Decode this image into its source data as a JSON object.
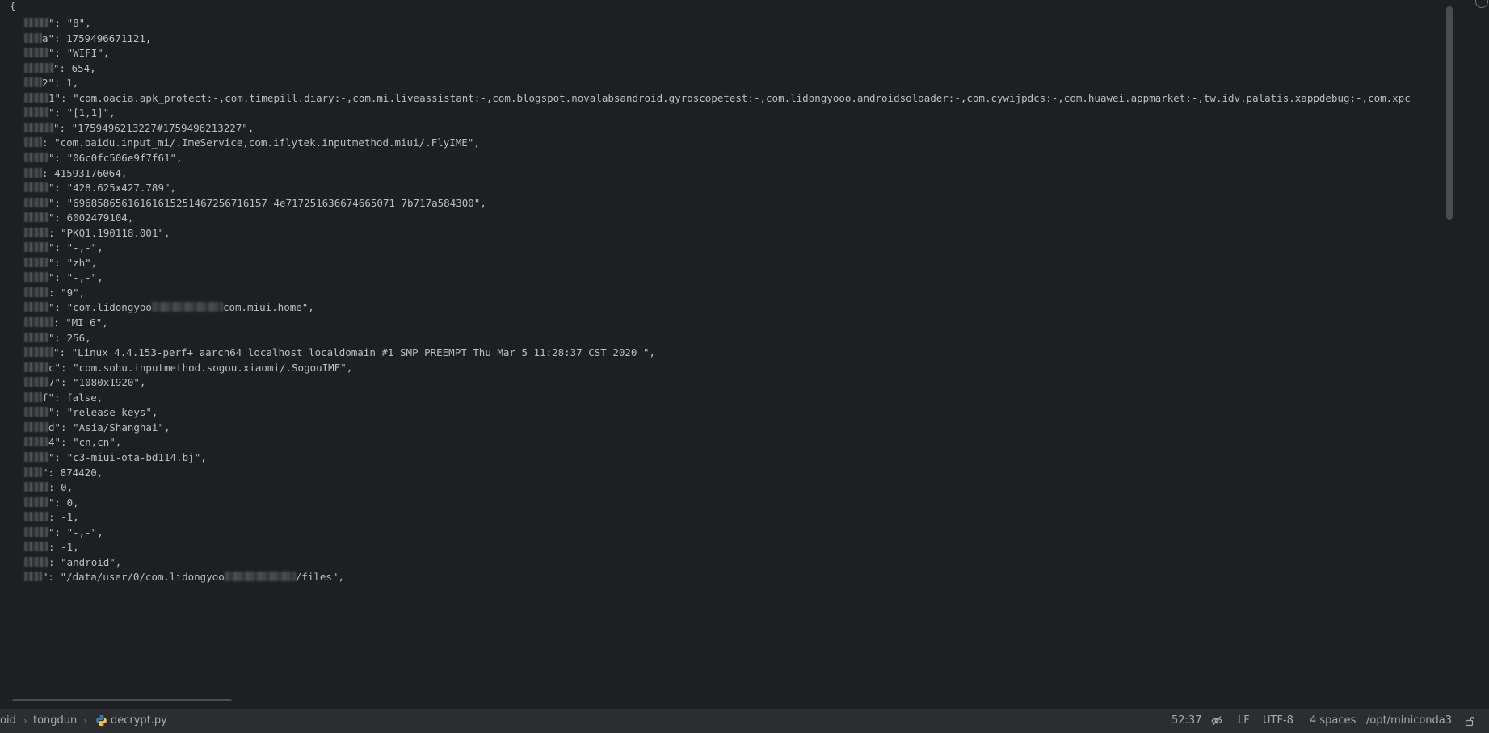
{
  "editor": {
    "open_brace": "{",
    "lines": [
      {
        "key_visible": "\": ",
        "value": "\"8\","
      },
      {
        "key_visible": "a\": ",
        "value": "1759496671121,"
      },
      {
        "key_visible": "\": ",
        "value": "\"WIFI\","
      },
      {
        "key_visible": "\": ",
        "value": "654,"
      },
      {
        "key_visible": "2\": ",
        "value": "1,"
      },
      {
        "key_visible": "1\": ",
        "value": "\"com.oacia.apk_protect:-,com.timepill.diary:-,com.mi.liveassistant:-,com.blogspot.novalabsandroid.gyroscopetest:-,com.lidongyooo.androidsoloader:-,com.cywijpdcs:-,com.huawei.appmarket:-,tw.idv.palatis.xappdebug:-,com.xpc"
      },
      {
        "key_visible": "\": ",
        "value": "\"[1,1]\","
      },
      {
        "key_visible": "\": ",
        "value": "\"1759496213227#1759496213227\","
      },
      {
        "key_visible": ": ",
        "value": "\"com.baidu.input_mi/.ImeService,com.iflytek.inputmethod.miui/.FlyIME\","
      },
      {
        "key_visible": "\": ",
        "value": "\"06c0fc506e9f7f61\","
      },
      {
        "key_visible": ": ",
        "value": "41593176064,"
      },
      {
        "key_visible": "\": ",
        "value": "\"428.625x427.789\","
      },
      {
        "key_visible": "\": ",
        "value": "\"69685865616161615251467256716157 4e717251636674665071 7b717a584300\","
      },
      {
        "key_visible": "\": ",
        "value": "6002479104,"
      },
      {
        "key_visible": ": ",
        "value": "\"PKQ1.190118.001\","
      },
      {
        "key_visible": "\": ",
        "value": "\"-,-\","
      },
      {
        "key_visible": "\": ",
        "value": "\"zh\","
      },
      {
        "key_visible": "\": ",
        "value": "\"-,-\","
      },
      {
        "key_visible": ": ",
        "value": "\"9\","
      },
      {
        "key_visible": "\": ",
        "value": "\"com.lidongyoo",
        "value_after_redaction": "com.miui.home\","
      },
      {
        "key_visible": ": ",
        "value": "\"MI 6\","
      },
      {
        "key_visible": "\": ",
        "value": "256,"
      },
      {
        "key_visible": "\": ",
        "value": "\"Linux 4.4.153-perf+ aarch64 localhost localdomain #1 SMP PREEMPT Thu Mar 5 11:28:37 CST 2020 \","
      },
      {
        "key_visible": "c\": ",
        "value": "\"com.sohu.inputmethod.sogou.xiaomi/.SogouIME\","
      },
      {
        "key_visible": "7\": ",
        "value": "\"1080x1920\","
      },
      {
        "key_visible": "f\": ",
        "value": "false,"
      },
      {
        "key_visible": "\": ",
        "value": "\"release-keys\","
      },
      {
        "key_visible": "d\": ",
        "value": "\"Asia/Shanghai\","
      },
      {
        "key_visible": "4\": ",
        "value": "\"cn,cn\","
      },
      {
        "key_visible": "\": ",
        "value": "\"c3-miui-ota-bd114.bj\","
      },
      {
        "key_visible": "\": ",
        "value": "874420,"
      },
      {
        "key_visible": ": ",
        "value": "0,"
      },
      {
        "key_visible": "\": ",
        "value": "0,"
      },
      {
        "key_visible": ": ",
        "value": "-1,"
      },
      {
        "key_visible": "\": ",
        "value": "\"-,-\","
      },
      {
        "key_visible": ": ",
        "value": "-1,"
      },
      {
        "key_visible": ": ",
        "value": "\"android\","
      },
      {
        "key_visible": "\": ",
        "value": "\"/data/user/0/com.lidongyoo",
        "value_after_redaction": "/files\","
      }
    ]
  },
  "statusbar": {
    "breadcrumb": [
      "oid",
      "tongdun",
      "decrypt.py"
    ],
    "cursor_position": "52:37",
    "line_separator": "LF",
    "encoding": "UTF-8",
    "indent": "4 spaces",
    "interpreter": "/opt/miniconda3"
  },
  "icons": {
    "file_type": "python-file-icon",
    "readonly": "readonly-toggle-icon",
    "lock": "lock-icon",
    "corner": "notifications-icon"
  },
  "colors": {
    "editor_bg": "#1e1f22",
    "statusbar_bg": "#2b2d30",
    "text": "#bcbec4",
    "python_blue": "#3d7ab8",
    "python_yellow": "#f2c94c"
  }
}
